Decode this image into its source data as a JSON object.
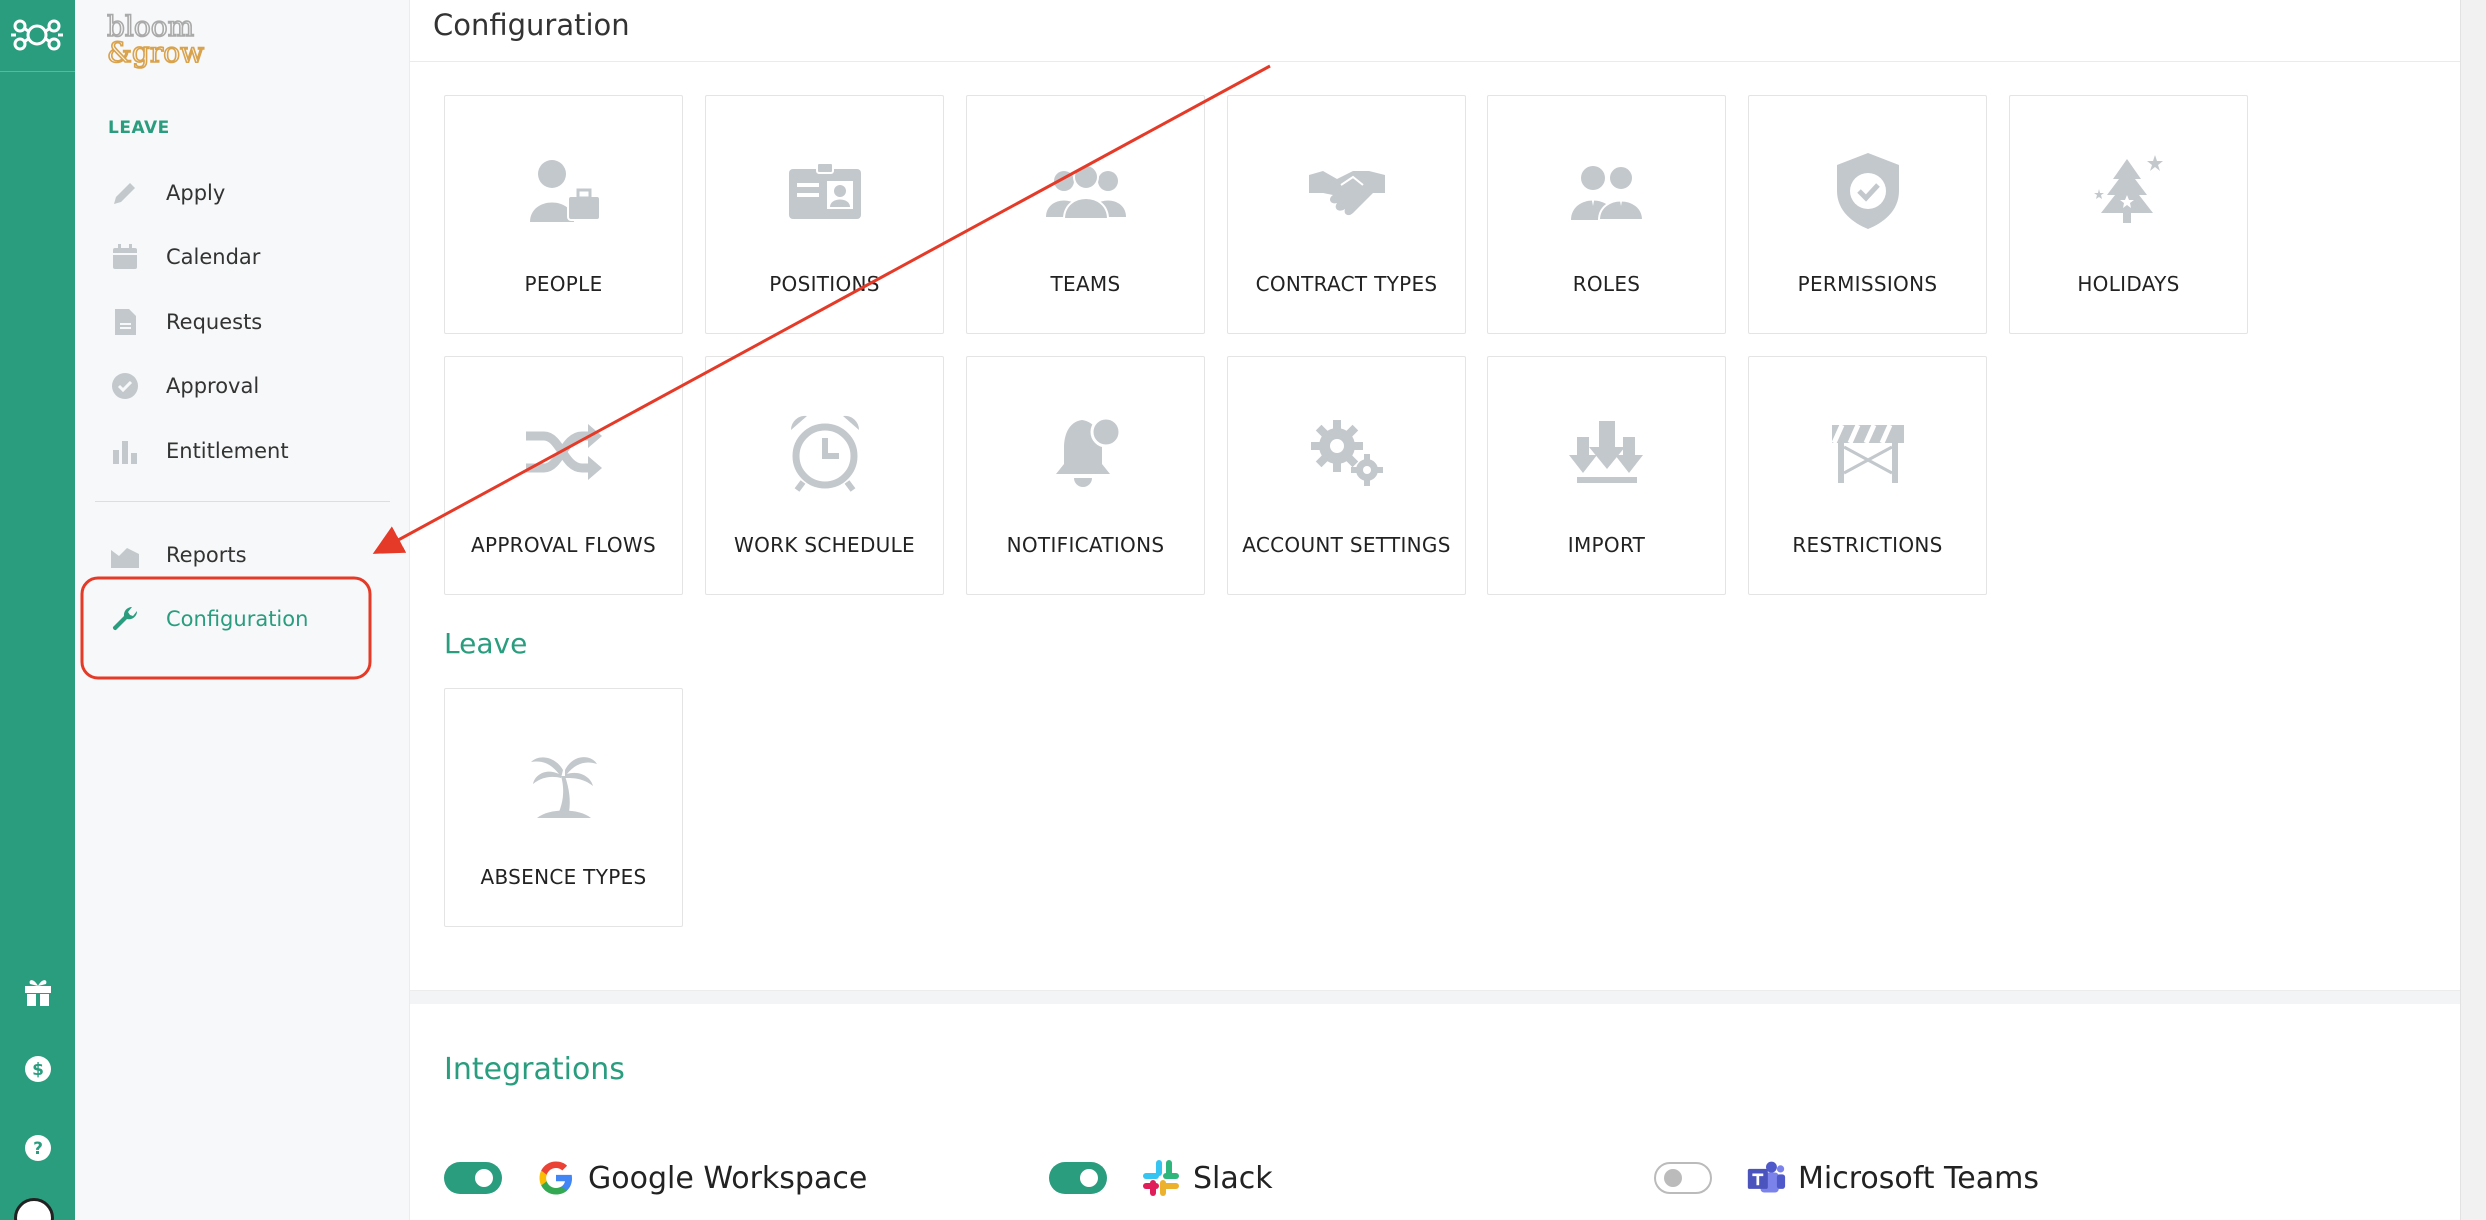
{
  "brand": {
    "logo_text": "bloom & grow"
  },
  "sidebar": {
    "section_title": "LEAVE",
    "items": [
      {
        "label": "Apply",
        "icon": "pencil-icon"
      },
      {
        "label": "Calendar",
        "icon": "calendar-icon"
      },
      {
        "label": "Requests",
        "icon": "document-icon"
      },
      {
        "label": "Approval",
        "icon": "check-circle-icon"
      },
      {
        "label": "Entitlement",
        "icon": "bar-chart-icon"
      }
    ],
    "secondary_items": [
      {
        "label": "Reports",
        "icon": "area-chart-icon"
      },
      {
        "label": "Configuration",
        "icon": "wrench-icon",
        "active": true
      }
    ]
  },
  "header": {
    "title": "Configuration"
  },
  "config_cards": [
    {
      "label": "PEOPLE",
      "icon": "person-briefcase-icon"
    },
    {
      "label": "POSITIONS",
      "icon": "id-card-icon"
    },
    {
      "label": "TEAMS",
      "icon": "group-icon"
    },
    {
      "label": "CONTRACT TYPES",
      "icon": "handshake-icon"
    },
    {
      "label": "ROLES",
      "icon": "roles-icon"
    },
    {
      "label": "PERMISSIONS",
      "icon": "shield-check-icon"
    },
    {
      "label": "HOLIDAYS",
      "icon": "christmas-tree-icon"
    },
    {
      "label": "APPROVAL FLOWS",
      "icon": "shuffle-icon"
    },
    {
      "label": "WORK SCHEDULE",
      "icon": "alarm-clock-icon"
    },
    {
      "label": "NOTIFICATIONS",
      "icon": "bell-icon"
    },
    {
      "label": "ACCOUNT SETTINGS",
      "icon": "gears-icon"
    },
    {
      "label": "IMPORT",
      "icon": "download-arrows-icon"
    },
    {
      "label": "RESTRICTIONS",
      "icon": "barrier-icon"
    }
  ],
  "leave_section": {
    "heading": "Leave",
    "cards": [
      {
        "label": "ABSENCE TYPES",
        "icon": "palm-tree-icon"
      }
    ]
  },
  "integrations": {
    "heading": "Integrations",
    "items": [
      {
        "label": "Google Workspace",
        "enabled": true,
        "icon": "google-icon"
      },
      {
        "label": "Slack",
        "enabled": true,
        "icon": "slack-icon"
      },
      {
        "label": "Microsoft Teams",
        "enabled": false,
        "icon": "teams-icon"
      }
    ]
  },
  "colors": {
    "accent": "#2a9d7f",
    "icon_gray": "#c3c8cc",
    "annotation": "#e53a27"
  }
}
